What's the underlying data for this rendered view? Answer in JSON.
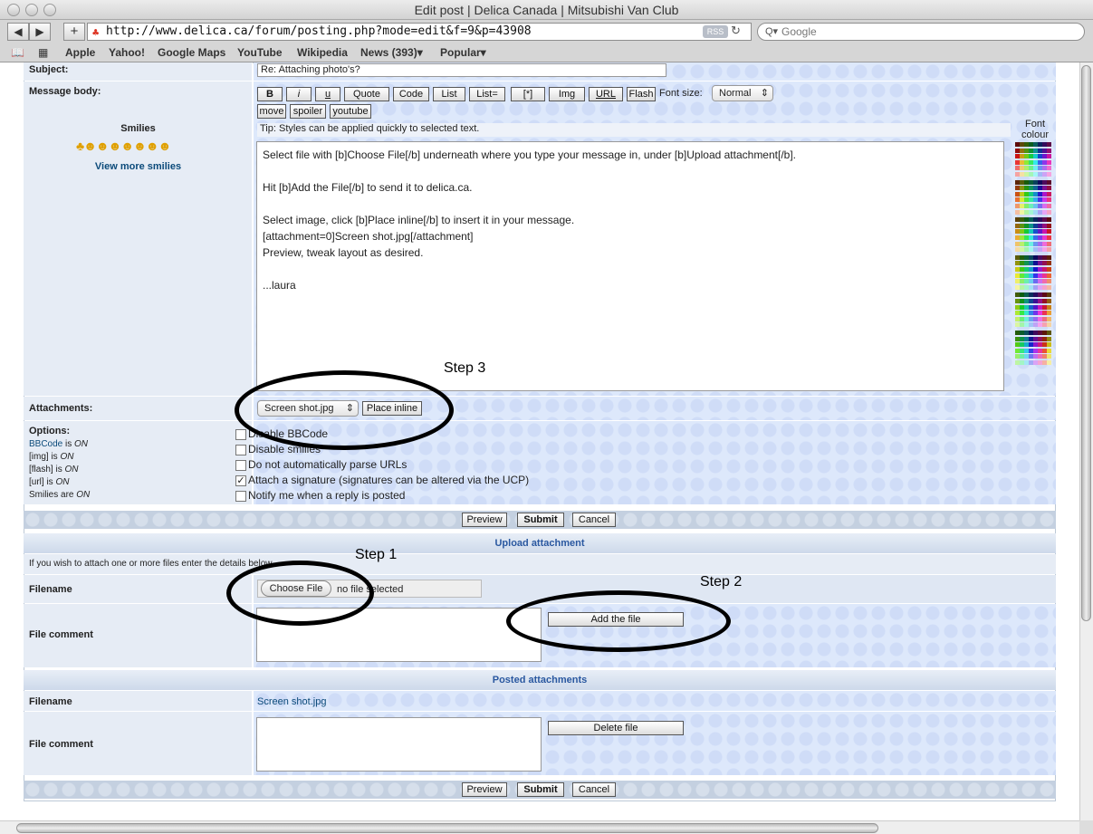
{
  "window": {
    "title": "Edit post | Delica Canada | Mitsubishi Van Club"
  },
  "browser": {
    "url": "http://www.delica.ca/forum/posting.php?mode=edit&f=9&p=43908",
    "rss_label": "RSS",
    "search_placeholder": "Google",
    "bookmarks": [
      "Apple",
      "Yahoo!",
      "Google Maps",
      "YouTube",
      "Wikipedia",
      "News (393)▾",
      "Popular▾"
    ]
  },
  "form": {
    "subject_label": "Subject:",
    "subject_value": "Re: Attaching photo's?",
    "message_label": "Message body:",
    "smilies_label": "Smilies",
    "view_more_smilies": "View more smilies",
    "buttons": [
      "B",
      "i",
      "u",
      "Quote",
      "Code",
      "List",
      "List=",
      "[*]",
      "Img",
      "URL",
      "Flash"
    ],
    "buttons_row2": [
      "move",
      "spoiler",
      "youtube"
    ],
    "font_size_label": "Font size:",
    "font_size_value": "Normal",
    "font_colour_label": "Font colour",
    "tip": "Tip: Styles can be applied quickly to selected text.",
    "message_lines": [
      "Select file with [b]Choose File[/b] underneath where you type your message in, under [b]Upload attachment[/b].",
      "",
      "Hit [b]Add the File[/b] to send it to delica.ca.",
      "",
      "Select image, click [b]Place inline[/b] to insert it in your message.",
      "[attachment=0]Screen shot.jpg[/attachment]",
      "Preview, tweak layout as desired.",
      "",
      "...laura"
    ],
    "attachments_label": "Attachments:",
    "attachment_select": "Screen shot.jpg",
    "place_inline": "Place inline",
    "options_label": "Options:",
    "bbcode_status": {
      "name": "BBCode",
      "text": " is ",
      "state": "ON"
    },
    "img_status": {
      "name": "[img]",
      "text": " is ",
      "state": "ON"
    },
    "flash_status": {
      "name": "[flash]",
      "text": " is ",
      "state": "ON"
    },
    "url_status": {
      "name": "[url]",
      "text": " is ",
      "state": "ON"
    },
    "smilies_status": {
      "name": "Smilies are ",
      "state": "ON"
    },
    "checkboxes": [
      {
        "label": "Disable BBCode",
        "checked": false
      },
      {
        "label": "Disable smilies",
        "checked": false
      },
      {
        "label": "Do not automatically parse URLs",
        "checked": false
      },
      {
        "label": "Attach a signature (signatures can be altered via the UCP)",
        "checked": true
      },
      {
        "label": "Notify me when a reply is posted",
        "checked": false
      }
    ],
    "preview": "Preview",
    "submit": "Submit",
    "cancel": "Cancel"
  },
  "upload": {
    "heading": "Upload attachment",
    "intro": "If you wish to attach one or more files enter the details below.",
    "filename_label": "Filename",
    "choose_file": "Choose File",
    "no_file": "no file selected",
    "file_comment_label": "File comment",
    "add_file": "Add the file"
  },
  "posted": {
    "heading": "Posted attachments",
    "filename_label": "Filename",
    "filename_value": "Screen shot.jpg",
    "file_comment_label": "File comment",
    "delete_file": "Delete file"
  },
  "annotations": {
    "step1": "Step 1",
    "step2": "Step 2",
    "step3": "Step 3"
  }
}
